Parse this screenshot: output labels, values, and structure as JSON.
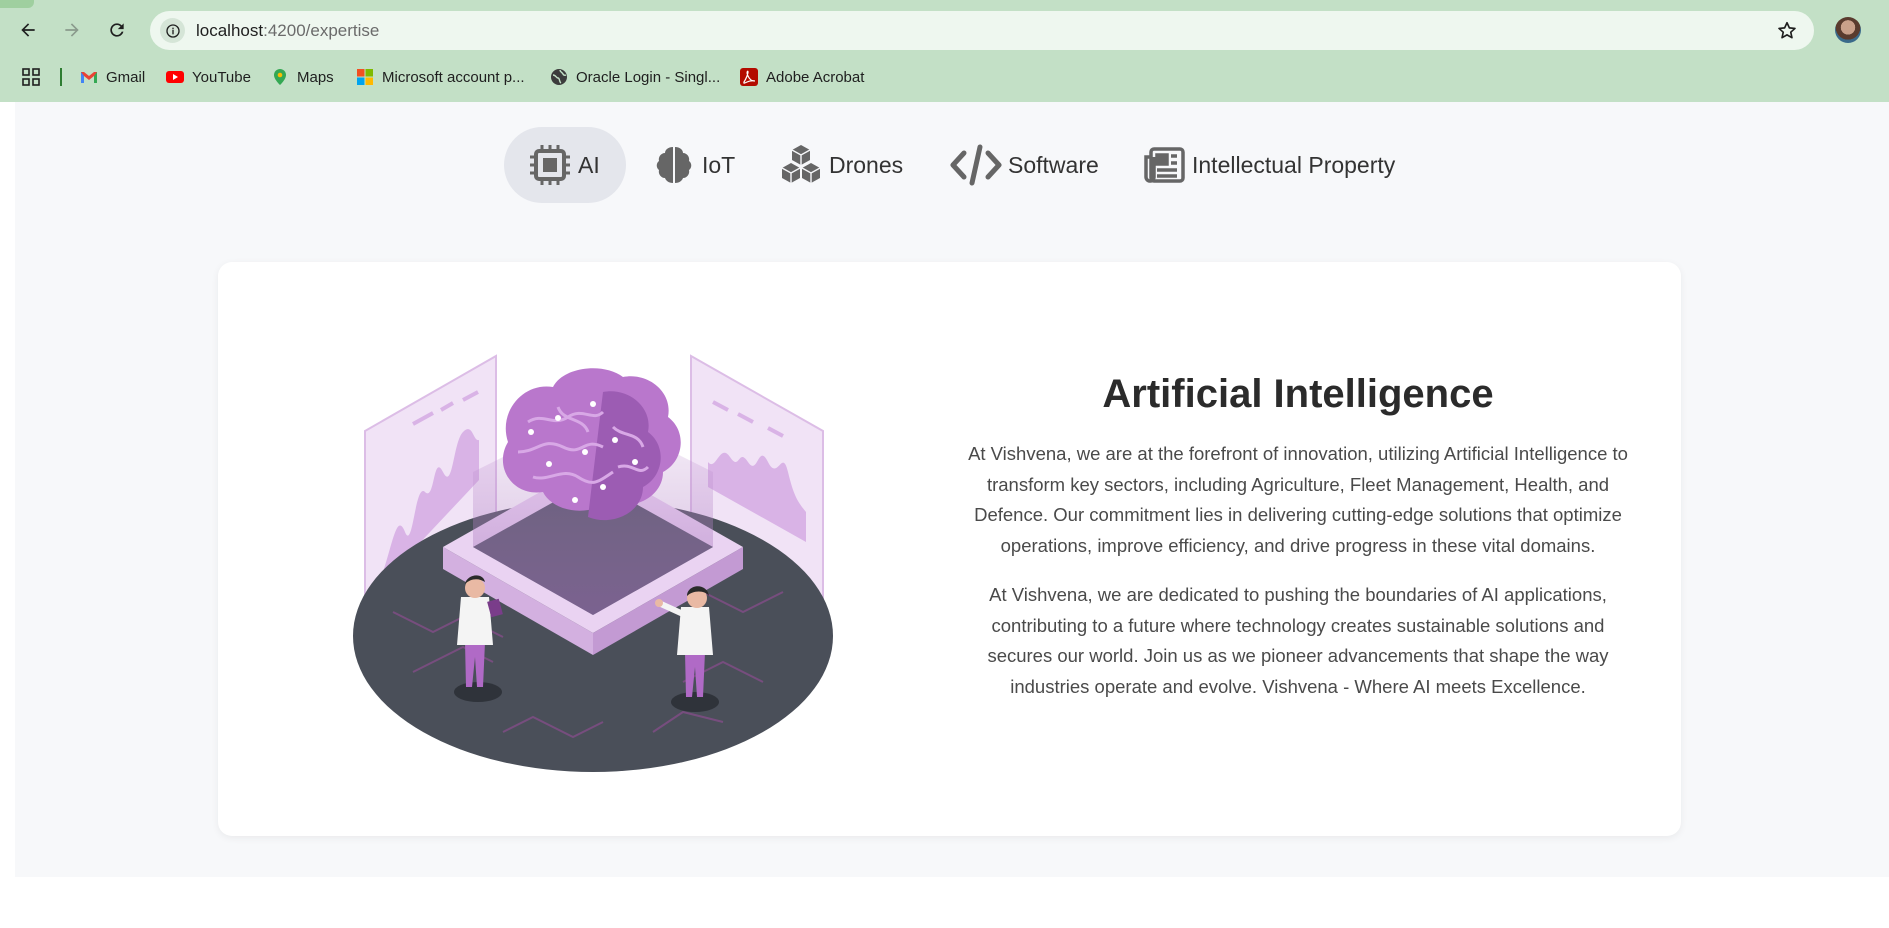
{
  "browser": {
    "url_host": "localhost",
    "url_path": ":4200/expertise",
    "bookmarks": [
      {
        "label": "Gmail",
        "icon": "gmail-icon"
      },
      {
        "label": "YouTube",
        "icon": "youtube-icon"
      },
      {
        "label": "Maps",
        "icon": "maps-icon"
      },
      {
        "label": "Microsoft account p...",
        "icon": "microsoft-icon"
      },
      {
        "label": "Oracle Login - Singl...",
        "icon": "globe-icon"
      },
      {
        "label": "Adobe Acrobat",
        "icon": "acrobat-icon"
      }
    ]
  },
  "tabs": [
    {
      "label": "AI",
      "icon": "chip-icon",
      "active": true
    },
    {
      "label": "IoT",
      "icon": "brain-icon",
      "active": false
    },
    {
      "label": "Drones",
      "icon": "cubes-icon",
      "active": false
    },
    {
      "label": "Software",
      "icon": "code-icon",
      "active": false
    },
    {
      "label": "Intellectual Property",
      "icon": "newspaper-icon",
      "active": false
    }
  ],
  "content": {
    "title": "Artificial Intelligence",
    "paragraphs": [
      "At Vishvena, we are at the forefront of innovation, utilizing Artificial Intelligence to transform key sectors, including Agriculture, Fleet Management, Health, and Defence. Our commitment lies in delivering cutting-edge solutions that optimize operations, improve efficiency, and drive progress in these vital domains.",
      "At Vishvena, we are dedicated to pushing the boundaries of AI applications, contributing to a future where technology creates sustainable solutions and secures our world. Join us as we pioneer advancements that shape the way industries operate and evolve. Vishvena - Where AI meets Excellence."
    ]
  },
  "colors": {
    "chrome": "#c3e0c6",
    "active_tab_bg": "#e4e6ec",
    "illustration_accent": "#b06ac6"
  }
}
